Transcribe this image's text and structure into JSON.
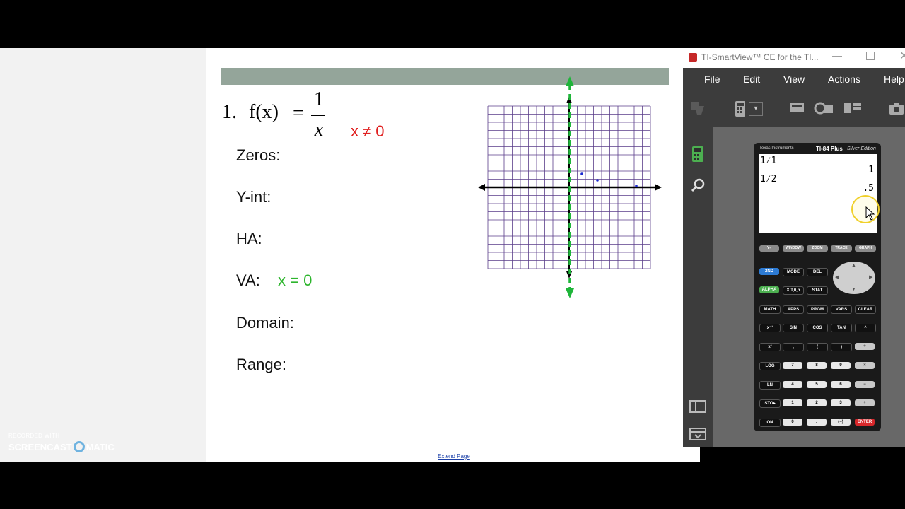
{
  "worksheet": {
    "problem_number": "1.",
    "function_lhs": "f(x)",
    "equals": "=",
    "numerator": "1",
    "denominator": "x",
    "restriction": "x ≠ 0",
    "labels": {
      "zeros": "Zeros:",
      "yint": "Y-int:",
      "ha": "HA:",
      "va": "VA:",
      "domain": "Domain:",
      "range": "Range:"
    },
    "va_answer": "x = 0",
    "extend_link": "Extend Page"
  },
  "watermark": {
    "top": "RECORDED WITH",
    "left": "SCREENCAST",
    "right": "MATIC"
  },
  "smartview": {
    "title": "TI-SmartView™ CE for the TI...",
    "menu": [
      "File",
      "Edit",
      "View",
      "Actions",
      "Help"
    ],
    "calculator": {
      "brand": "Texas Instruments",
      "model": "TI-84 Plus",
      "edition": "Silver Edition",
      "screen_lines": [
        {
          "expr": "1⁄1",
          "result": "1"
        },
        {
          "expr": "1⁄2",
          "result": ".5"
        }
      ],
      "fn_keys": [
        "Y=",
        "WINDOW",
        "ZOOM",
        "TRACE",
        "GRAPH"
      ],
      "keys": [
        [
          "2ND",
          "MODE",
          "DEL"
        ],
        [
          "ALPHA",
          "X,T,θ,n",
          "STAT"
        ],
        [
          "MATH",
          "APPS",
          "PRGM",
          "VARS",
          "CLEAR"
        ],
        [
          "x⁻¹",
          "SIN",
          "COS",
          "TAN",
          "^"
        ],
        [
          "x²",
          ",",
          "(",
          ")",
          "÷"
        ],
        [
          "LOG",
          "7",
          "8",
          "9",
          "×"
        ],
        [
          "LN",
          "4",
          "5",
          "6",
          "−"
        ],
        [
          "STO▸",
          "1",
          "2",
          "3",
          "+"
        ],
        [
          "ON",
          "0",
          ".",
          "(−)",
          "ENTER"
        ]
      ]
    }
  },
  "colors": {
    "restriction": "#e02020",
    "va_answer": "#2db52d",
    "asymptote": "#1fb53a",
    "grid": "#5a3d8a"
  }
}
